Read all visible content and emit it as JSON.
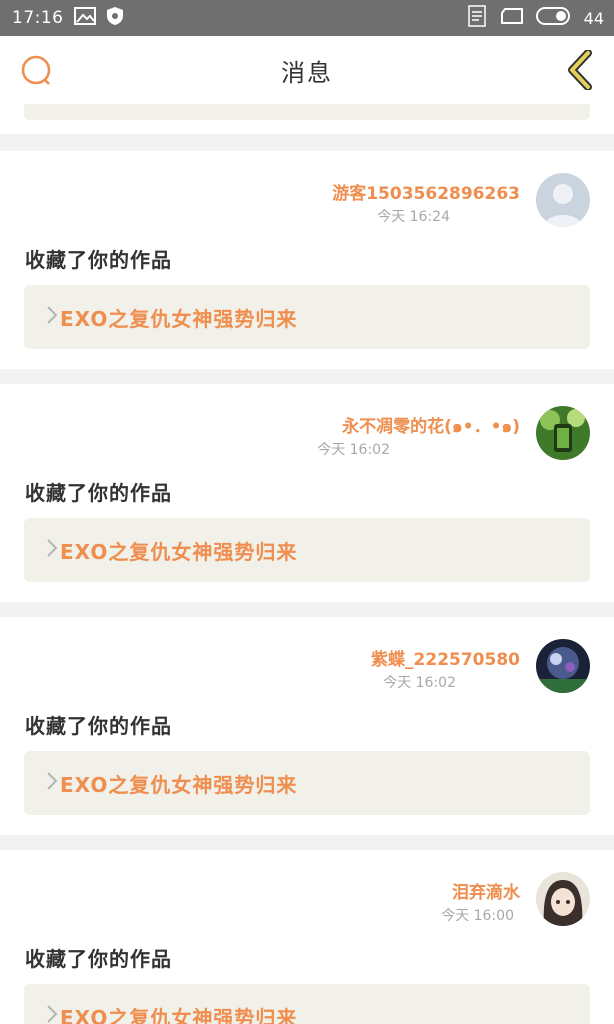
{
  "status_bar": {
    "time": "17:16",
    "battery": "44",
    "icons": [
      "image-icon",
      "shield-icon",
      "app-notification-icon",
      "tablet-icon",
      "battery-icon"
    ]
  },
  "header": {
    "title": "消息",
    "search_icon": "search-icon",
    "back_icon": "chevron-left-icon"
  },
  "colors": {
    "accent": "#ef8e4e",
    "card_bg": "#ffffff",
    "page_bg": "#f2f2f2",
    "link_box_bg": "#f1f1ea",
    "back_icon": "#e5d15a"
  },
  "messages": [
    {
      "user": "游客1503562896263",
      "time": "今天 16:24",
      "action": "收藏了你的作品",
      "work": "EXO之复仇女神强势归来",
      "avatar": "default-avatar"
    },
    {
      "user": "永不凋零的花(๑•．•๑)",
      "time": "今天 16:02",
      "action": "收藏了你的作品",
      "work": "EXO之复仇女神强势归来",
      "avatar": "green-plant-avatar"
    },
    {
      "user": "紫蝶_222570580",
      "time": "今天 16:02",
      "action": "收藏了你的作品",
      "work": "EXO之复仇女神强势归来",
      "avatar": "night-scene-avatar"
    },
    {
      "user": "泪弃滴水",
      "time": "今天 16:00",
      "action": "收藏了你的作品",
      "work": "EXO之复仇女神强势归来",
      "avatar": "anime-girl-avatar"
    }
  ]
}
